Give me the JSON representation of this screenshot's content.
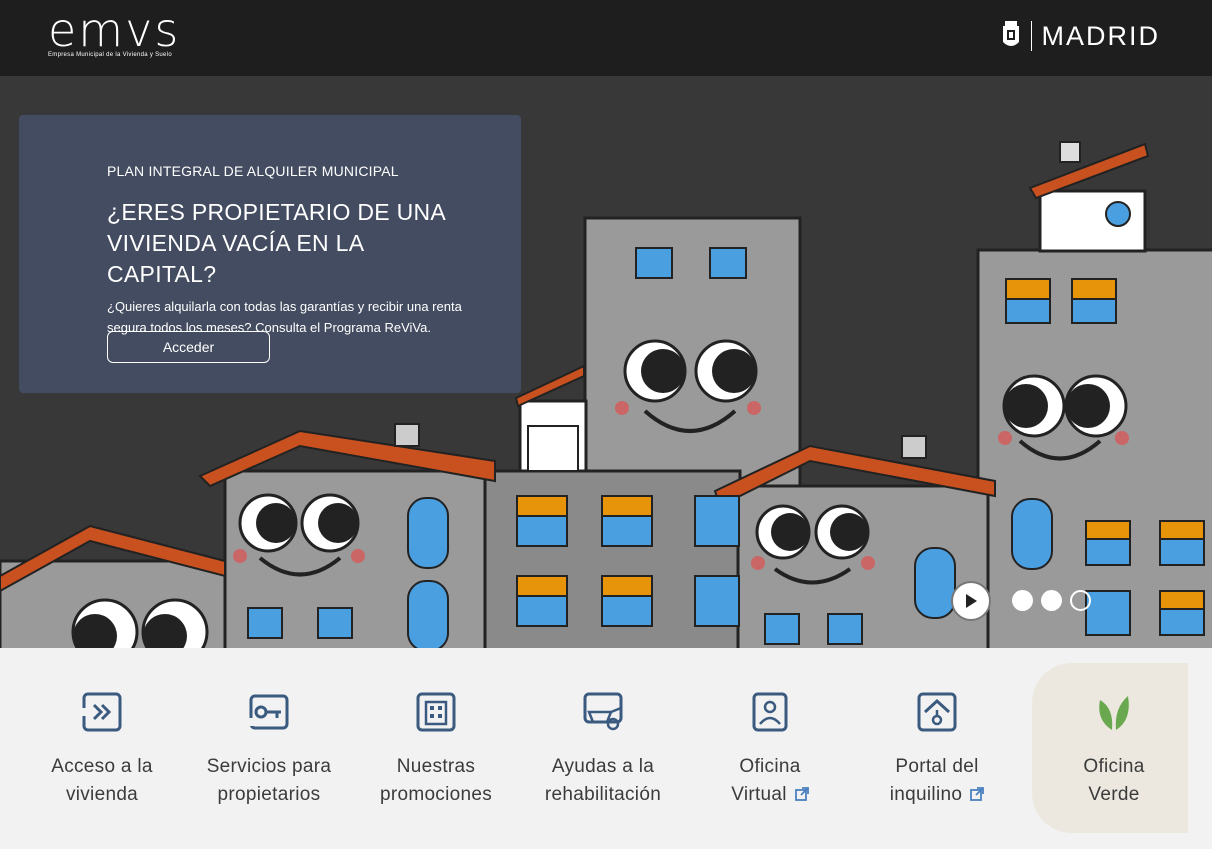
{
  "header": {
    "logo_text": "emvs",
    "logo_subtitle": "Empresa Municipal de la Vivienda y Suelo",
    "city_text": "MADRID",
    "crest_icon": "madrid-crest-icon"
  },
  "hero": {
    "kicker": "PLAN INTEGRAL DE ALQUILER MUNICIPAL",
    "title_line1": "¿ERES PROPIETARIO DE UNA",
    "title_line2": "VIVIENDA VACÍA EN LA CAPITAL?",
    "description_line1": "¿Quieres alquilarla con todas las garantías y recibir una renta",
    "description_line2": "segura todos los meses? Consulta el Programa ReViVa.",
    "button_label": "Acceder",
    "carousel": {
      "slides": 3,
      "active": 3,
      "control_icon": "play-icon"
    }
  },
  "colors": {
    "header_bg": "#1e1e1e",
    "promo_bg": "#434c60",
    "icon_blue": "#3a5a80",
    "leaf_green": "#6aa84f",
    "roof_orange": "#c8511f"
  },
  "nav": [
    {
      "line1": "Acceso a la",
      "line2": "vivienda",
      "icon": "double-chevron-icon",
      "external": false
    },
    {
      "line1": "Servicios para",
      "line2": "propietarios",
      "icon": "key-hand-icon",
      "external": false
    },
    {
      "line1": "Nuestras",
      "line2": "promociones",
      "icon": "building-icon",
      "external": false
    },
    {
      "line1": "Ayudas a la",
      "line2": "rehabilitación",
      "icon": "wheelbarrow-icon",
      "external": false
    },
    {
      "line1": "Oficina",
      "line2": "Virtual",
      "icon": "agent-screen-icon",
      "external": true
    },
    {
      "line1": "Portal del",
      "line2": "inquilino",
      "icon": "house-key-icon",
      "external": true
    },
    {
      "line1": "Oficina",
      "line2": "Verde",
      "icon": "leaf-icon",
      "external": false
    }
  ]
}
